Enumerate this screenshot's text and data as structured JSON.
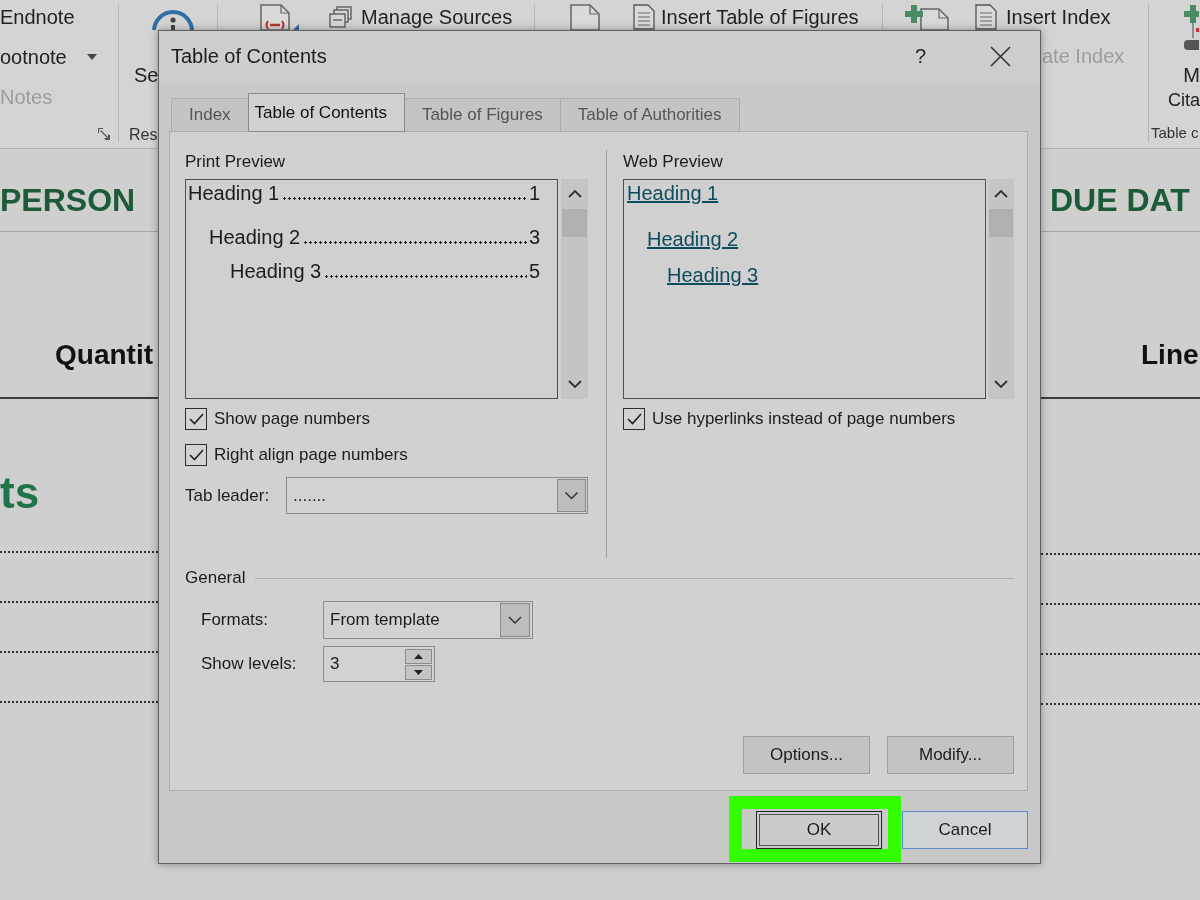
{
  "ribbon": {
    "footnotes": {
      "items": [
        {
          "label": "Endnote",
          "disabled": false,
          "dropdown": false
        },
        {
          "label": "ootnote",
          "disabled": false,
          "dropdown": true
        },
        {
          "label": "Notes",
          "disabled": true,
          "dropdown": false
        }
      ]
    },
    "research": {
      "command": "Se",
      "group_label": "Res"
    },
    "citations": {
      "commands": [
        {
          "label": "Manage Sources",
          "disabled": false
        }
      ]
    },
    "captions": {
      "commands": [
        {
          "label": "Insert Table of Figures",
          "disabled": false
        }
      ]
    },
    "index": {
      "commands": [
        {
          "label": "Insert Index",
          "disabled": false
        },
        {
          "label": "ate Index",
          "disabled": true
        }
      ]
    },
    "authorities": {
      "command_lines": [
        "M",
        "Cita"
      ],
      "group_label": "Table c"
    }
  },
  "document": {
    "left": {
      "header": "PERSON",
      "column_label": "Quantit",
      "section_heading": "ts"
    },
    "right": {
      "header": "DUE DAT",
      "column_label": "Line"
    }
  },
  "dialog": {
    "title": "Table of Contents",
    "help": "?",
    "tabs": [
      {
        "label": "Index",
        "selected": false
      },
      {
        "label": "Table of Contents",
        "selected": true
      },
      {
        "label": "Table of Figures",
        "selected": false
      },
      {
        "label": "Table of Authorities",
        "selected": false
      }
    ],
    "print_preview": {
      "label": "Print Preview",
      "entries": [
        {
          "text": "Heading 1",
          "page": "1",
          "children": [
            {
              "text": "Heading 2",
              "page": "3",
              "children": [
                {
                  "text": "Heading 3",
                  "page": "5"
                }
              ]
            }
          ]
        }
      ]
    },
    "print_options": [
      {
        "label": "Show page numbers",
        "checked": true
      },
      {
        "label": "Right align page numbers",
        "checked": true
      }
    ],
    "tab_leader": {
      "label": "Tab leader:",
      "value": "......."
    },
    "web_preview": {
      "label": "Web Preview",
      "entries": [
        {
          "text": "Heading 1",
          "children": [
            {
              "text": "Heading 2",
              "children": [
                {
                  "text": "Heading 3"
                }
              ]
            }
          ]
        }
      ]
    },
    "web_options": [
      {
        "label": "Use hyperlinks instead of page numbers",
        "checked": true
      }
    ],
    "general": {
      "label": "General",
      "formats": {
        "label": "Formats:",
        "value": "From template"
      },
      "show_levels": {
        "label": "Show levels:",
        "value": "3"
      }
    },
    "side_buttons": [
      "Options...",
      "Modify..."
    ],
    "footer_buttons": [
      {
        "label": "OK",
        "default": true,
        "highlighted": true
      },
      {
        "label": "Cancel",
        "default": false,
        "highlighted": false
      }
    ]
  }
}
